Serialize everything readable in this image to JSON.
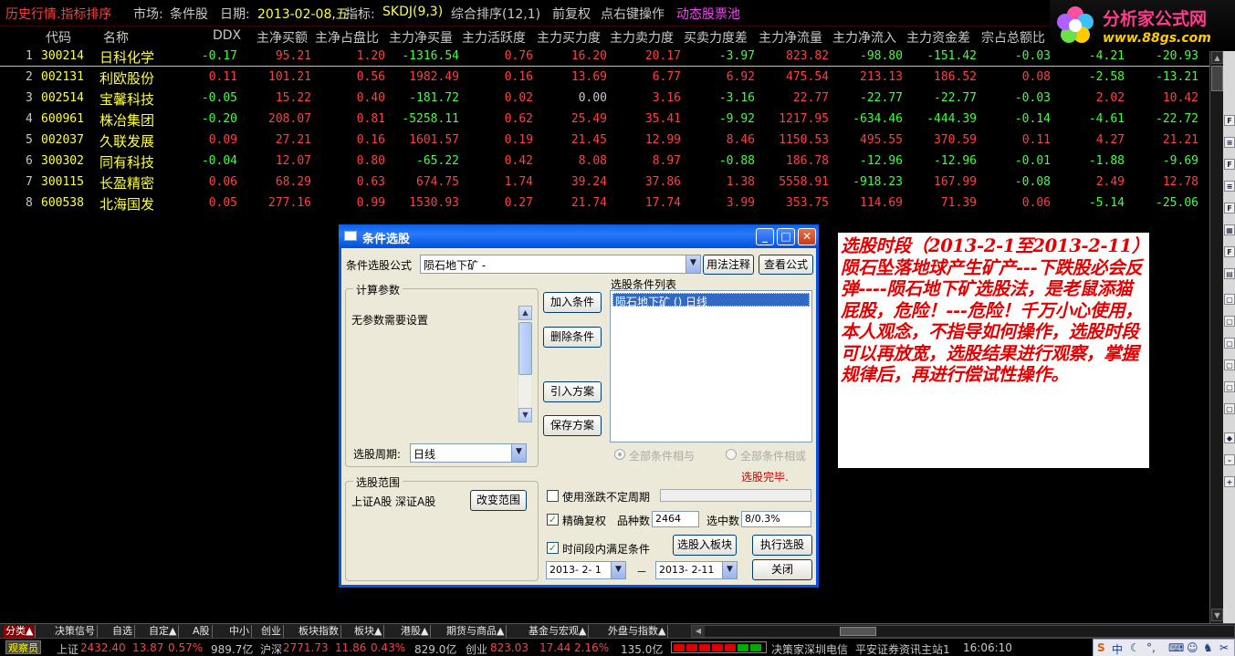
{
  "titlebar": {
    "title": "历史行情.指标排序",
    "market_label": "市场:",
    "market_value": "条件股",
    "date_label": "日期:",
    "date_value": "2013-02-08,五",
    "indicator_label": "指标:",
    "indicator_value": "SKDJ(9,3)",
    "rank_label": "综合排序(12,1)",
    "adjust": "前复权",
    "right_click": "点右键操作",
    "dynamic_pool": "动态股票池"
  },
  "logo": {
    "name": "分析家公式网",
    "url": "www.88gs.com"
  },
  "table": {
    "headers": [
      "代码",
      "名称",
      "DDX",
      "主净买额",
      "主净占盘比",
      "主力净买量",
      "主力活跃度",
      "主力买力度",
      "主力卖力度",
      "买卖力度差",
      "主力净流量",
      "主力净流入",
      "主力资金差",
      "宗占总额比"
    ],
    "rows": [
      {
        "idx": "1",
        "code": "300214",
        "name": "日科化学",
        "v": [
          "-0.17",
          "95.21",
          "1.20",
          "-1316.54",
          "0.76",
          "16.20",
          "20.17",
          "-3.97",
          "823.82",
          "-98.80",
          "-151.42",
          "-0.03",
          "-4.21",
          "-20.93"
        ]
      },
      {
        "idx": "2",
        "code": "002131",
        "name": "利欧股份",
        "v": [
          "0.11",
          "101.21",
          "0.56",
          "1982.49",
          "0.16",
          "13.69",
          "6.77",
          "6.92",
          "475.54",
          "213.13",
          "186.52",
          "0.08",
          "-2.58",
          "-13.21"
        ]
      },
      {
        "idx": "3",
        "code": "002514",
        "name": "宝馨科技",
        "v": [
          "-0.05",
          "15.22",
          "0.40",
          "-181.72",
          "0.02",
          "0.00",
          "3.16",
          "-3.16",
          "22.77",
          "-22.77",
          "-22.77",
          "-0.03",
          "2.02",
          "10.42"
        ]
      },
      {
        "idx": "4",
        "code": "600961",
        "name": "株冶集团",
        "v": [
          "-0.20",
          "208.07",
          "0.81",
          "-5258.11",
          "0.62",
          "25.49",
          "35.41",
          "-9.92",
          "1217.95",
          "-634.46",
          "-444.39",
          "-0.14",
          "-4.61",
          "-22.72"
        ]
      },
      {
        "idx": "5",
        "code": "002037",
        "name": "久联发展",
        "v": [
          "0.09",
          "27.21",
          "0.16",
          "1601.57",
          "0.19",
          "21.45",
          "12.99",
          "8.46",
          "1150.53",
          "495.55",
          "370.59",
          "0.11",
          "4.27",
          "21.21"
        ]
      },
      {
        "idx": "6",
        "code": "300302",
        "name": "同有科技",
        "v": [
          "-0.04",
          "12.07",
          "0.80",
          "-65.22",
          "0.42",
          "8.08",
          "8.97",
          "-0.88",
          "186.78",
          "-12.96",
          "-12.96",
          "-0.01",
          "-1.88",
          "-9.69"
        ]
      },
      {
        "idx": "7",
        "code": "300115",
        "name": "长盈精密",
        "v": [
          "0.06",
          "68.29",
          "0.63",
          "674.75",
          "1.74",
          "39.24",
          "37.86",
          "1.38",
          "5558.91",
          "-918.23",
          "167.99",
          "-0.08",
          "2.49",
          "12.78"
        ]
      },
      {
        "idx": "8",
        "code": "600538",
        "name": "北海国发",
        "v": [
          "0.05",
          "277.16",
          "0.99",
          "1530.93",
          "0.27",
          "21.74",
          "17.74",
          "3.99",
          "353.75",
          "114.69",
          "71.39",
          "0.06",
          "-5.14",
          "-25.06"
        ]
      }
    ]
  },
  "dialog": {
    "title": "条件选股",
    "formula_label": "条件选股公式",
    "formula_value": "陨石地下矿 -",
    "usage_btn": "用法注释",
    "view_btn": "查看公式",
    "params_group": "计算参数",
    "params_text": "无参数需要设置",
    "add_btn": "加入条件",
    "delete_btn": "删除条件",
    "import_btn": "引入方案",
    "save_btn": "保存方案",
    "cond_list_label": "选股条件列表",
    "cond_list_item": "陨石地下矿 () 日线",
    "period_label": "选股周期:",
    "period_value": "日线",
    "radio_and": "全部条件相与",
    "radio_or": "全部条件相或",
    "done_text": "选股完毕.",
    "scope_group": "选股范围",
    "scope_text": "上证A股 深证A股",
    "change_scope_btn": "改变范围",
    "chk_variable_period": "使用涨跌不定周期",
    "chk_precise": "精确复权",
    "count_label": "品种数",
    "count_value": "2464",
    "selected_label": "选中数",
    "selected_value": "8/0.3%",
    "chk_timeframe": "时间段内满足条件",
    "to_block_btn": "选股入板块",
    "execute_btn": "执行选股",
    "date_from": "2013- 2- 1",
    "date_sep": "－",
    "date_to": "2013- 2-11",
    "close_btn": "关闭"
  },
  "note": {
    "text": "选股时段（2013-2-1至2013-2-11）陨石坠落地球产生矿产---下跌股必会反弹----陨石地下矿选股法，是老鼠添猫屁股，危险！---危险！千万小心使用，本人观念，不指导如何操作，选股时段可以再放宽，选股结果进行观察，掌握规律后，再进行偿试性操作。"
  },
  "tabs": [
    "分类▲",
    "决策信号",
    "自选",
    "自定▲",
    "A股",
    "中小",
    "创业",
    "板块指数",
    "板块▲",
    "港股▲",
    "期货与商品▲",
    "基金与宏观▲",
    "外盘与指数▲"
  ],
  "statusbar": {
    "observer": "观察员",
    "sh_label": "上证",
    "sh_value": "2432.40",
    "sh_change": "13.87",
    "sh_pct": "0.57%",
    "sh_amount": "989.7亿",
    "hs_label": "沪深",
    "hs_value": "2771.73",
    "hs_change": "11.86",
    "hs_pct": "0.43%",
    "hs_amount": "829.0亿",
    "cy_label": "创业",
    "cy_value": "823.03",
    "cy_change": "17.44",
    "cy_pct": "2.16%",
    "cy_amount": "135.0亿",
    "broker": "决策家深圳电信",
    "info": "平安证券资讯主站1",
    "time": "16:06:10",
    "ime_label": "中"
  },
  "colors": {
    "positive": "#ff4040",
    "negative": "#40ff40",
    "note_text": "#e40000",
    "dialog_title": "#0a5fe8"
  }
}
